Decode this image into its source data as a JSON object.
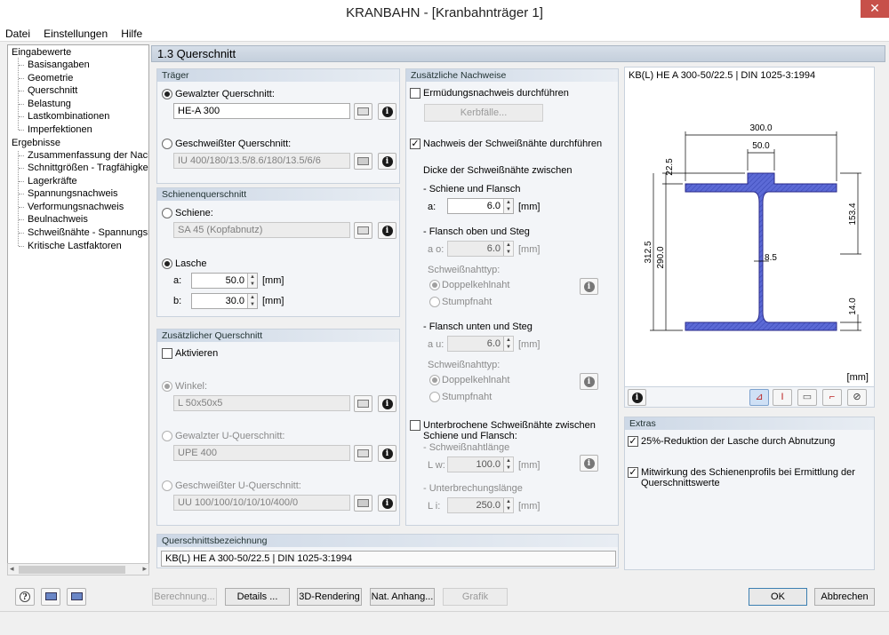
{
  "window": {
    "title": "KRANBAHN - [Kranbahnträger 1]",
    "close": "✕"
  },
  "menu": [
    "Datei",
    "Einstellungen",
    "Hilfe"
  ],
  "tree": {
    "input_root": "Eingabewerte",
    "input_items": [
      "Basisangaben",
      "Geometrie",
      "Querschnitt",
      "Belastung",
      "Lastkombinationen",
      "Imperfektionen"
    ],
    "results_root": "Ergebnisse",
    "results_items": [
      "Zusammenfassung der Nachwe",
      "Schnittgrößen - Tragfähigkeit",
      "Lagerkräfte",
      "Spannungsnachweis",
      "Verformungsnachweis",
      "Beulnachweis",
      "Schweißnähte - Spannungsnac",
      "Kritische Lastfaktoren"
    ]
  },
  "page_title": "1.3 Querschnitt",
  "traeger": {
    "header": "Träger",
    "rolled_label": "Gewalzter Querschnitt:",
    "rolled_value": "HE-A 300",
    "welded_label": "Geschweißter Querschnitt:",
    "welded_value": "IU 400/180/13.5/8.6/180/13.5/6/6"
  },
  "schiene": {
    "header": "Schienenquerschnitt",
    "rail_label": "Schiene:",
    "rail_value": "SA 45 (Kopfabnutz)",
    "lasche_label": "Lasche",
    "a_label": "a:",
    "a_value": "50.0",
    "b_label": "b:",
    "b_value": "30.0",
    "unit": "[mm]"
  },
  "zusatz_qs": {
    "header": "Zusätzlicher Querschnitt",
    "activate_label": "Aktivieren",
    "angle_label": "Winkel:",
    "angle_value": "L 50x50x5",
    "rolled_u_label": "Gewalzter U-Querschnitt:",
    "rolled_u_value": "UPE 400",
    "welded_u_label": "Geschweißter U-Querschnitt:",
    "welded_u_value": "UU 100/100/10/10/10/400/0"
  },
  "bezeichnung": {
    "header": "Querschnittsbezeichnung",
    "value": "KB(L) HE A 300-50/22.5 | DIN 1025-3:1994"
  },
  "nachweise": {
    "header": "Zusätzliche Nachweise",
    "fatigue_label": "Ermüdungsnachweis durchführen",
    "kerbfaelle": "Kerbfälle...",
    "weld_label": "Nachweis der Schweißnähte durchführen",
    "thickness_label": "Dicke der Schweißnähte zwischen",
    "rail_flange": "- Schiene und Flansch",
    "a_label": "a:",
    "a_value": "6.0",
    "flange_top": "- Flansch oben und Steg",
    "ao_label": "a o:",
    "ao_value": "6.0",
    "weld_type_label": "Schweißnahttyp:",
    "double_fillet": "Doppelkehlnaht",
    "butt": "Stumpfnaht",
    "flange_bottom": "- Flansch unten und Steg",
    "au_label": "a u:",
    "au_value": "6.0",
    "interrupted_label": "Unterbrochene Schweißnähte zwischen Schiene und Flansch:",
    "weld_length_label": "- Schweißnahtlänge",
    "lw_label": "L w:",
    "lw_value": "100.0",
    "gap_length_label": "- Unterbrechungslänge",
    "li_label": "L i:",
    "li_value": "250.0",
    "unit": "[mm]"
  },
  "preview": {
    "caption": "KB(L) HE A 300-50/22.5 | DIN 1025-3:1994",
    "unit": "[mm]",
    "dims": {
      "width": "300.0",
      "plate": "50.0",
      "plate_h": "22.5",
      "total_h": "312.5",
      "beam_h": "290.0",
      "upper": "153.4",
      "web": "8.5",
      "flange": "14.0"
    }
  },
  "extras": {
    "header": "Extras",
    "reduction_label": "25%-Reduktion der Lasche durch Abnutzung",
    "participation_label": "Mitwirkung des Schienenprofils bei Ermittlung der Querschnittswerte"
  },
  "buttons": {
    "calc": "Berechnung...",
    "details": "Details ...",
    "rendering": "3D-Rendering",
    "annex": "Nat. Anhang...",
    "graphic": "Grafik",
    "ok": "OK",
    "cancel": "Abbrechen"
  },
  "colors": {
    "section_fill": "#5c6ad6",
    "header_bg": "#cdd8e6"
  }
}
